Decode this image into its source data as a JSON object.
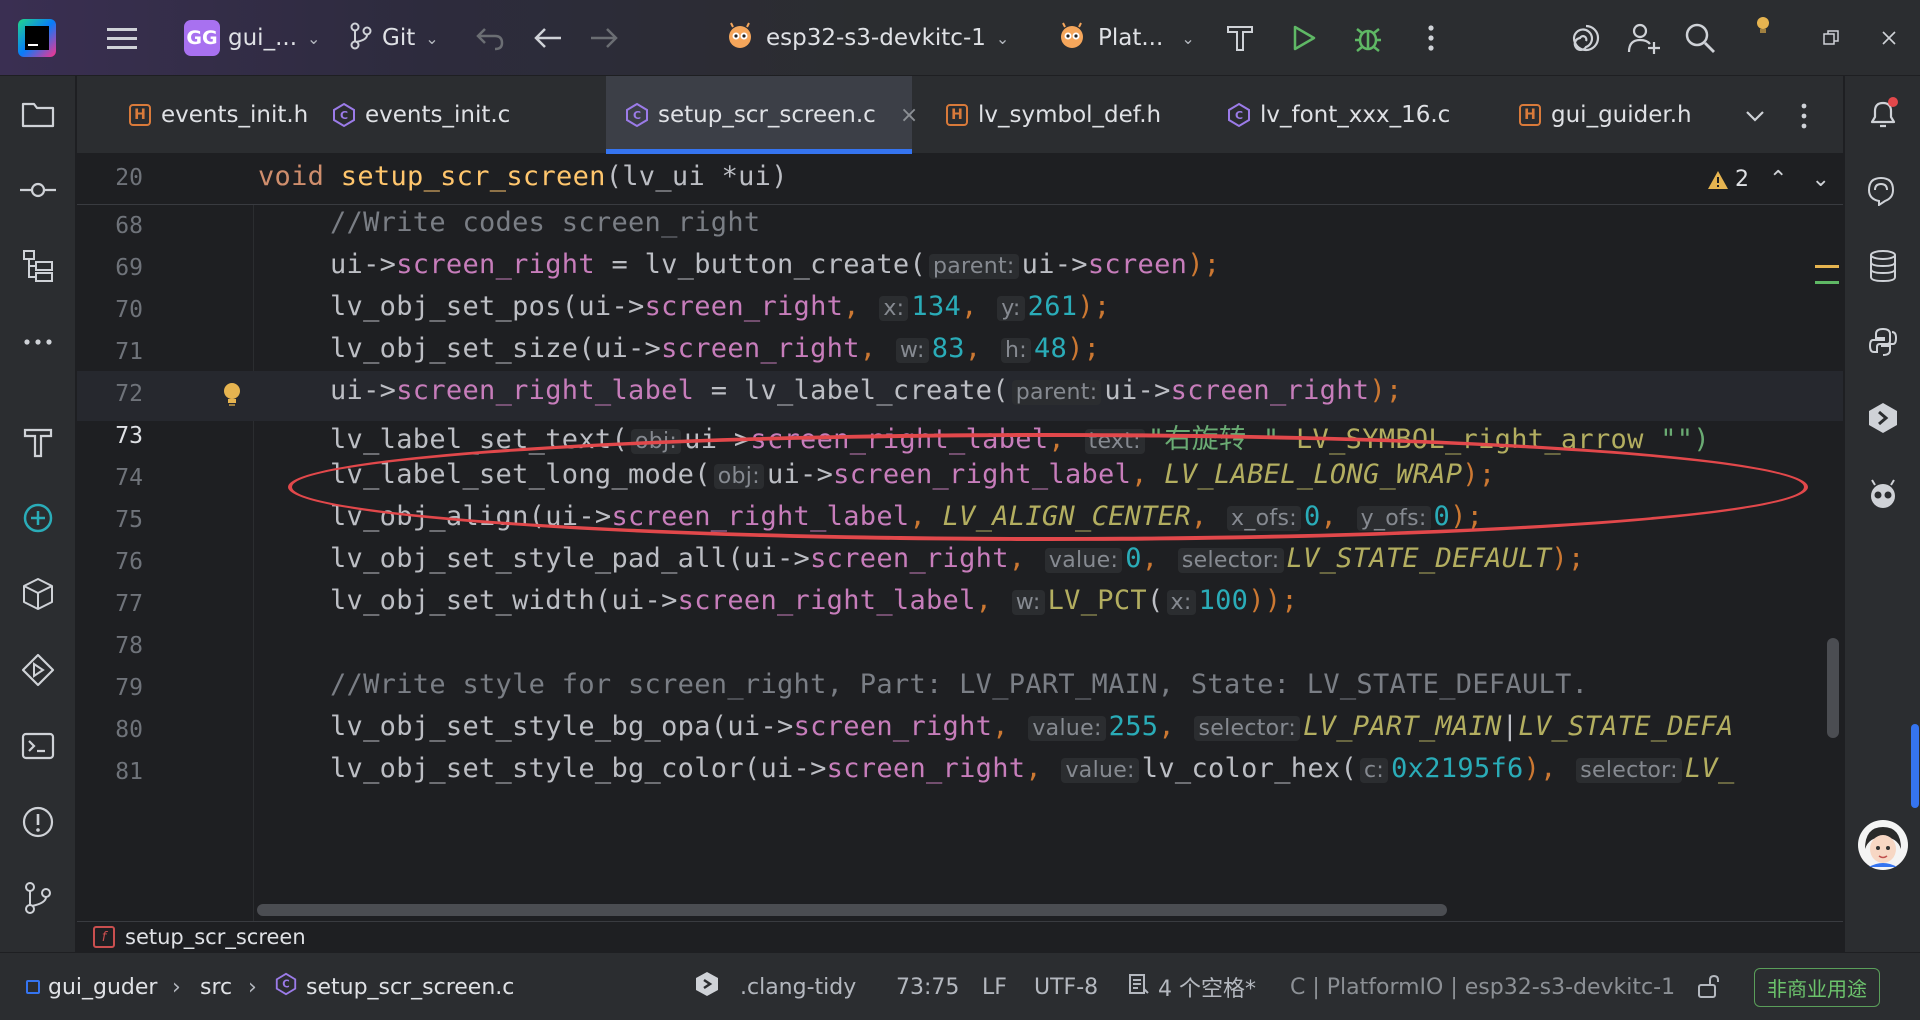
{
  "titlebar": {
    "project_badge": "GG",
    "project_name": "gui_...",
    "vcs_label": "Git",
    "run_config": "esp32-s3-devkitc-1",
    "plugin_label": "Plat..."
  },
  "tabs": [
    {
      "label": "events_init.h",
      "type": "H"
    },
    {
      "label": "events_init.c",
      "type": "C"
    },
    {
      "label": "setup_scr_screen.c",
      "type": "C",
      "active": true
    },
    {
      "label": "lv_symbol_def.h",
      "type": "H"
    },
    {
      "label": "lv_font_xxx_16.c",
      "type": "C"
    },
    {
      "label": "gui_guider.h",
      "type": "H"
    }
  ],
  "editor": {
    "warning_count": "2",
    "sticky": {
      "line": "20",
      "kw": "void",
      "fn": "setup_scr_screen",
      "rest": "(lv_ui *ui)"
    },
    "lines": {
      "l68": "68",
      "l69": "69",
      "l70": "70",
      "l71": "71",
      "l72": "72",
      "l73": "73",
      "l74": "74",
      "l75": "75",
      "l76": "76",
      "l77": "77",
      "l78": "78",
      "l79": "79",
      "l80": "80",
      "l81": "81"
    },
    "code": {
      "c68": "//Write codes screen_right",
      "c69_a": "ui->",
      "c69_b": "screen_right",
      "c69_c": " = lv_button_create(",
      "c69_hint": "parent:",
      "c69_d": "ui->",
      "c69_e": "screen",
      "c69_f": ");",
      "c70_a": "lv_obj_set_pos(ui->",
      "c70_b": "screen_right",
      "c70_c": ", ",
      "c70_hx": "x:",
      "c70_x": "134",
      "c70_sep": ", ",
      "c70_hy": "y:",
      "c70_y": "261",
      "c70_end": ");",
      "c71_a": "lv_obj_set_size(ui->",
      "c71_b": "screen_right",
      "c71_c": ", ",
      "c71_hw": "w:",
      "c71_w": "83",
      "c71_sep": ", ",
      "c71_hh": "h:",
      "c71_h": "48",
      "c71_end": ");",
      "c72_a": "ui->",
      "c72_b": "screen_right_label",
      "c72_c": " = lv_label_create(",
      "c72_hint": "parent:",
      "c72_d": "ui->",
      "c72_e": "screen_right",
      "c72_f": ");",
      "c73_a": "lv_label_set_text(",
      "c73_hobj": "obj:",
      "c73_b": "ui->",
      "c73_c": "screen_right_label",
      "c73_d": ", ",
      "c73_htext": "text:",
      "c73_s1": "\"右旋转 \"",
      "c73_mac": " LV_SYMBOL_right_arrow ",
      "c73_s2": "\"\")",
      "c74_a": "lv_label_set_long_mode(",
      "c74_hobj": "obj:",
      "c74_b": "ui->",
      "c74_c": "screen_right_label",
      "c74_d": ", ",
      "c74_mac": "LV_LABEL_LONG_WRAP",
      "c74_end": ");",
      "c75_a": "lv_obj_align(ui->",
      "c75_b": "screen_right_label",
      "c75_c": ", ",
      "c75_mac": "LV_ALIGN_CENTER",
      "c75_d": ", ",
      "c75_hx": "x_ofs:",
      "c75_x": "0",
      "c75_e": ", ",
      "c75_hy": "y_ofs:",
      "c75_y": "0",
      "c75_end": ");",
      "c76_a": "lv_obj_set_style_pad_all(ui->",
      "c76_b": "screen_right",
      "c76_c": ", ",
      "c76_hv": "value:",
      "c76_v": "0",
      "c76_d": ", ",
      "c76_hs": "selector:",
      "c76_mac": "LV_STATE_DEFAULT",
      "c76_end": ");",
      "c77_a": "lv_obj_set_width(ui->",
      "c77_b": "screen_right_label",
      "c77_c": ", ",
      "c77_hw": "w:",
      "c77_mac": "LV_PCT",
      "c77_p": "(",
      "c77_hx": "x:",
      "c77_v": "100",
      "c77_end": "));",
      "c79": "//Write style for screen_right, Part: LV_PART_MAIN, State: LV_STATE_DEFAULT.",
      "c80_a": "lv_obj_set_style_bg_opa(ui->",
      "c80_b": "screen_right",
      "c80_c": ", ",
      "c80_hv": "value:",
      "c80_v": "255",
      "c80_d": ", ",
      "c80_hs": "selector:",
      "c80_mac1": "LV_PART_MAIN",
      "c80_bar": "|",
      "c80_mac2": "LV_STATE_DEFA",
      "c81_a": "lv_obj_set_style_bg_color(ui->",
      "c81_b": "screen_right",
      "c81_c": ", ",
      "c81_hv": "value:",
      "c81_d": "lv_color_hex(",
      "c81_hc": "c:",
      "c81_v": "0x2195f6",
      "c81_e": "), ",
      "c81_hs": "selector:",
      "c81_mac": "LV_"
    }
  },
  "breadcrumb_bar": {
    "fn_badge": "f",
    "fn_name": "setup_scr_screen"
  },
  "status": {
    "project": "gui_guder",
    "folder": "src",
    "file": "setup_scr_screen.c",
    "linter": ".clang-tidy",
    "position": "73:75",
    "line_ending": "LF",
    "encoding": "UTF-8",
    "indent": "4 个空格*",
    "context": "C | PlatformIO | esp32-s3-devkitc-1",
    "license": "非商业用途"
  },
  "colors": {
    "accent": "#3574f0",
    "annotation_ellipse": "#e2484b",
    "run_green": "#5fb865",
    "license_green": "#6cc36c"
  },
  "icons": [
    "app-logo-icon",
    "hamburger-menu-icon",
    "branch-icon",
    "undo-icon",
    "back-arrow-icon",
    "forward-arrow-icon",
    "build-hammer-icon",
    "run-icon",
    "debug-bug-icon",
    "more-vertical-icon",
    "ai-spiral-icon",
    "add-user-icon",
    "search-icon",
    "update-bulb-icon",
    "restore-window-icon",
    "close-window-icon",
    "folder-icon",
    "commit-icon",
    "structure-icon",
    "more-horizontal-icon",
    "hammer-icon",
    "add-circle-icon",
    "packages-icon",
    "run-debug-icon",
    "terminal-icon",
    "problems-icon",
    "git-icon",
    "notifications-icon",
    "ai-chat-icon",
    "database-icon",
    "python-icon",
    "plugin-icon",
    "platformio-icon",
    "avatar-icon"
  ]
}
